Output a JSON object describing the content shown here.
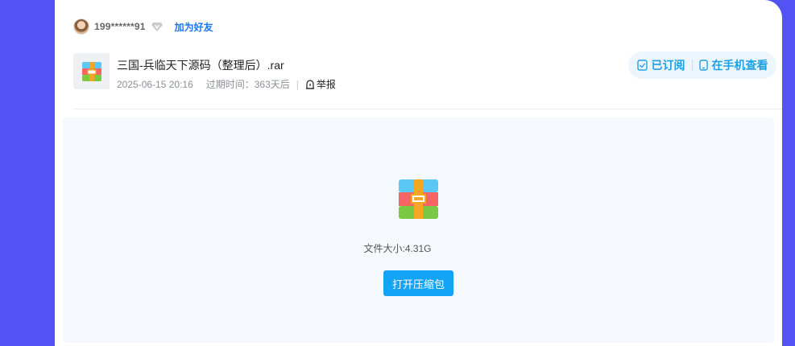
{
  "user": {
    "name": "199******91",
    "add_friend_label": "加为好友"
  },
  "file": {
    "title": "三国-兵临天下源码（整理后）.rar",
    "date": "2025-06-15 20:16",
    "expire": "过期时间：363天后",
    "report_label": "举报",
    "size_text": "文件大小:4.31G"
  },
  "actions": {
    "subscribed_label": "已订阅",
    "phone_view_label": "在手机查看"
  },
  "preview": {
    "open_button_label": "打开压缩包"
  },
  "colors": {
    "background": "#5252f5",
    "accent": "#14a4f5",
    "link": "#1677ff",
    "pill_text": "#1fa0e5"
  },
  "icons": [
    "avatar",
    "vip-diamond-icon",
    "archive-icon",
    "report-icon",
    "subscribed-icon",
    "phone-icon"
  ]
}
